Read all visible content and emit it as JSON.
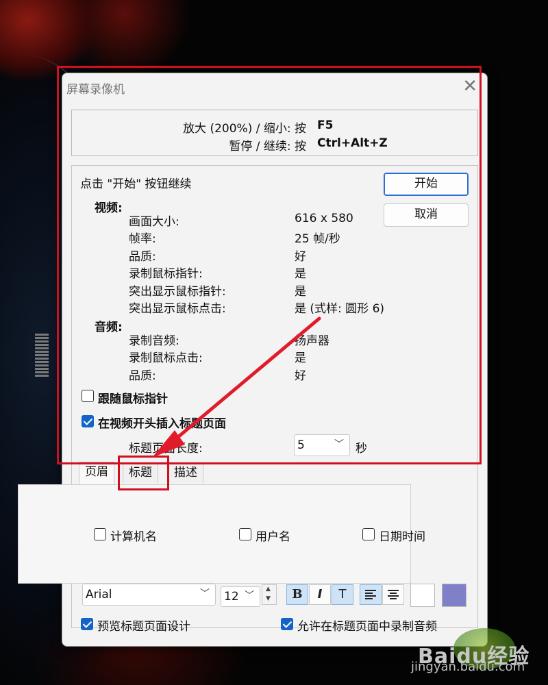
{
  "window": {
    "title": "屏幕录像机",
    "close_glyph": "✕"
  },
  "hotkeys": [
    {
      "label": "放大 (200%) / 缩小:  按",
      "key": "F5"
    },
    {
      "label": "暂停 / 继续:  按",
      "key": "Ctrl+Alt+Z"
    }
  ],
  "instruction": "点击 \"开始\" 按钮继续",
  "buttons": {
    "start": "开始",
    "cancel": "取消"
  },
  "video": {
    "heading": "视频:",
    "rows": [
      {
        "label": "画面大小:",
        "value": "616 x 580"
      },
      {
        "label": "帧率:",
        "value": "25 帧/秒"
      },
      {
        "label": "品质:",
        "value": "好"
      },
      {
        "label": "录制鼠标指针:",
        "value": "是"
      },
      {
        "label": "突出显示鼠标指针:",
        "value": "是"
      },
      {
        "label": "突出显示鼠标点击:",
        "value": "是 (式样:  圆形 6)"
      }
    ]
  },
  "audio": {
    "heading": "音频:",
    "rows": [
      {
        "label": "录制音频:",
        "value": "扬声器"
      },
      {
        "label": "录制鼠标点击:",
        "value": "是"
      },
      {
        "label": "品质:",
        "value": "好"
      }
    ]
  },
  "options": {
    "follow_cursor": {
      "label": "跟随鼠标指针",
      "checked": false
    },
    "insert_title": {
      "label": "在视频开头插入标题页面",
      "checked": true
    }
  },
  "title_length": {
    "label": "标题页面长度:",
    "value": "5",
    "unit": "秒"
  },
  "tabs": [
    {
      "label": "页眉",
      "active": true
    },
    {
      "label": "标题",
      "active": false
    },
    {
      "label": "描述",
      "active": false
    }
  ],
  "header_fields": {
    "computer_name": {
      "label": "计算机名",
      "checked": false
    },
    "user_name": {
      "label": "用户名",
      "checked": false
    },
    "date_time": {
      "label": "日期时间",
      "checked": false
    }
  },
  "format_toolbar": {
    "font": "Arial",
    "size": "12",
    "bold_glyph": "B",
    "italic_glyph": "I",
    "text_glyph": "T",
    "background_color": "#ffffff",
    "accent_color": "#7f80c8"
  },
  "footer": {
    "preview": {
      "label": "预览标题页面设计",
      "checked": true
    },
    "allow_audio": {
      "label": "允许在标题页面中录制音频",
      "checked": true
    }
  },
  "watermark": {
    "logo": "Baidu经验",
    "url": "jingyan.baidu.com"
  },
  "colors": {
    "highlight_red": "#d01020",
    "check_blue": "#1464c8"
  }
}
